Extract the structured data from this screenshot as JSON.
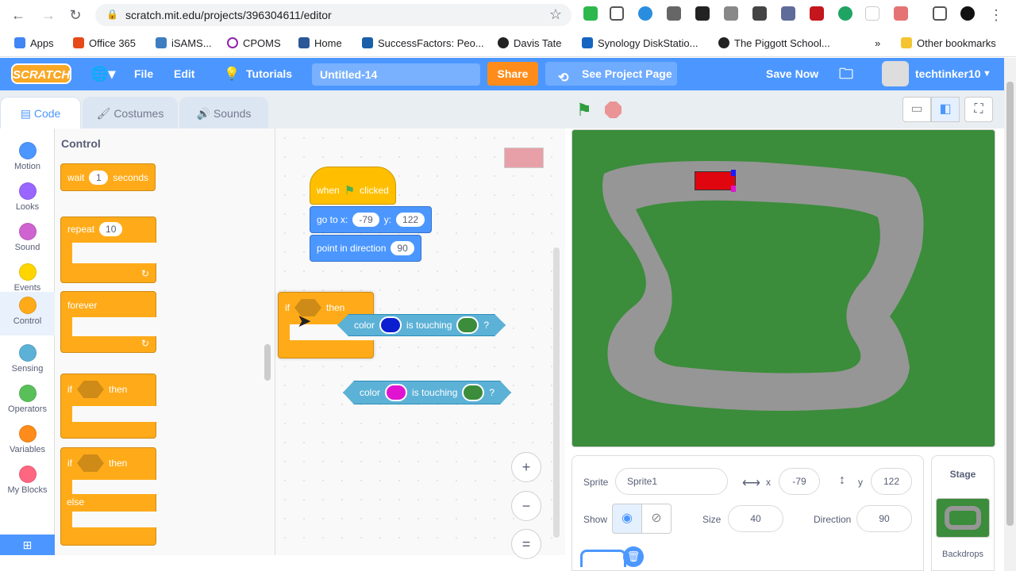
{
  "browser": {
    "url": "scratch.mit.edu/projects/396304611/editor",
    "bookmarks": [
      "Apps",
      "Office 365",
      "iSAMS...",
      "CPOMS",
      "Home",
      "SuccessFactors: Peo...",
      "Davis Tate",
      "Synology DiskStatio...",
      "The Piggott School...",
      "Other bookmarks"
    ],
    "more_glyph": "»"
  },
  "menu": {
    "logo": "SCRATCH",
    "file": "File",
    "edit": "Edit",
    "tutorials": "Tutorials",
    "project_title": "Untitled-14",
    "share": "Share",
    "see_project": "See Project Page",
    "save_now": "Save Now",
    "username": "techtinker10"
  },
  "tabs": {
    "code": "Code",
    "costumes": "Costumes",
    "sounds": "Sounds"
  },
  "categories": [
    {
      "label": "Motion",
      "color": "#4c97ff"
    },
    {
      "label": "Looks",
      "color": "#9966ff"
    },
    {
      "label": "Sound",
      "color": "#cf63cf"
    },
    {
      "label": "Events",
      "color": "#ffd500"
    },
    {
      "label": "Control",
      "color": "#ffab19"
    },
    {
      "label": "Sensing",
      "color": "#5cb1d6"
    },
    {
      "label": "Operators",
      "color": "#59c059"
    },
    {
      "label": "Variables",
      "color": "#ff8c1a"
    },
    {
      "label": "My Blocks",
      "color": "#ff6680"
    }
  ],
  "palette": {
    "heading": "Control",
    "wait": {
      "a": "wait",
      "value": "1",
      "b": "seconds"
    },
    "repeat": {
      "a": "repeat",
      "value": "10"
    },
    "forever": "forever",
    "if_then": {
      "a": "if",
      "b": "then"
    },
    "if_else": {
      "a": "if",
      "b": "then",
      "c": "else"
    }
  },
  "script": {
    "when_flag": {
      "a": "when",
      "b": "clicked"
    },
    "goto": {
      "a": "go to x:",
      "x": "-79",
      "b": "y:",
      "y": "122"
    },
    "point": {
      "a": "point in direction",
      "value": "90"
    },
    "if_block": {
      "a": "if",
      "b": "then"
    },
    "sensing1": {
      "a": "color",
      "b": "is touching",
      "c": "?",
      "color1": "#0b1fd0",
      "color2": "#3b8c3b"
    },
    "sensing2": {
      "a": "color",
      "b": "is touching",
      "c": "?",
      "color1": "#e014d0",
      "color2": "#3b8c3b"
    }
  },
  "zoom": {
    "in": "+",
    "out": "−",
    "reset": "="
  },
  "sprite_info": {
    "sprite_label": "Sprite",
    "sprite_name": "Sprite1",
    "x_label": "x",
    "x": "-79",
    "y_label": "y",
    "y": "122",
    "show_label": "Show",
    "size_label": "Size",
    "size": "40",
    "direction_label": "Direction",
    "direction": "90"
  },
  "stage_panel": {
    "title": "Stage",
    "backdrops": "Backdrops"
  },
  "colors": {
    "scratch_blue": "#4c97ff",
    "stage_green": "#3b8c3b",
    "track_gray": "#969696",
    "car_red": "#e0060f"
  }
}
